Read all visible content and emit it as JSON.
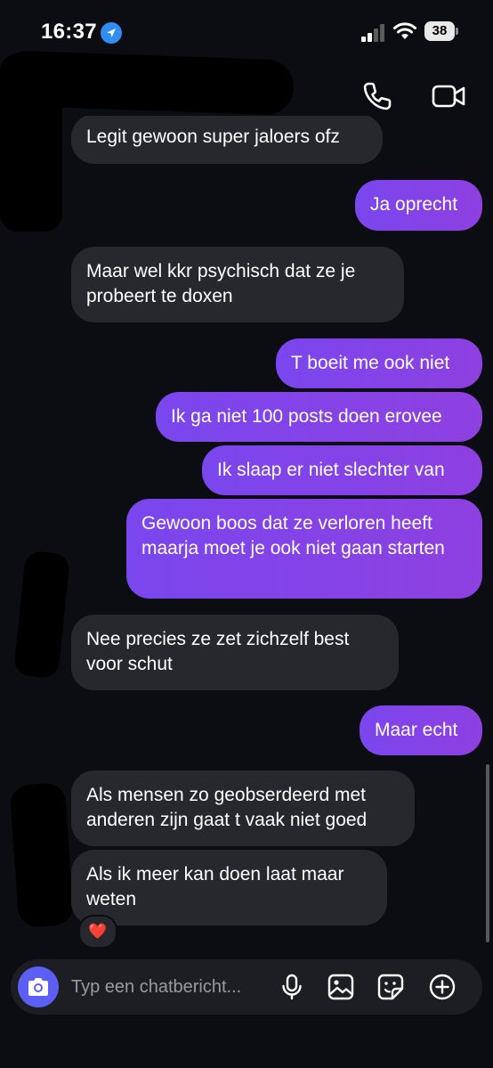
{
  "status_bar": {
    "time": "16:37",
    "battery": "38",
    "icons": [
      "location-arrow-icon",
      "signal-icon",
      "wifi-icon",
      "battery-icon"
    ]
  },
  "header": {
    "icons": [
      "phone-icon",
      "video-camera-icon"
    ]
  },
  "messages": [
    {
      "direction": "incoming",
      "text": "Legit gewoon super jaloers ofz"
    },
    {
      "direction": "outgoing",
      "text": "Ja oprecht"
    },
    {
      "direction": "incoming",
      "text": "Maar wel kkr psychisch dat ze je probeert te doxen"
    },
    {
      "direction": "outgoing",
      "text": "T boeit me ook niet"
    },
    {
      "direction": "outgoing",
      "text": "Ik ga niet 100 posts doen erovee"
    },
    {
      "direction": "outgoing",
      "text": "Ik slaap er niet slechter van"
    },
    {
      "direction": "outgoing",
      "text": "Gewoon boos dat ze verloren heeft maarja moet je ook niet gaan starten"
    },
    {
      "direction": "incoming",
      "text": "Nee precies ze zet zichzelf best voor schut"
    },
    {
      "direction": "outgoing",
      "text": "Maar echt"
    },
    {
      "direction": "incoming",
      "text": "Als mensen zo geobserdeerd met anderen zijn gaat t vaak niet goed"
    },
    {
      "direction": "incoming",
      "text": "Als ik meer kan doen laat maar weten"
    }
  ],
  "reaction": {
    "emoji": "❤️",
    "icon": "heart-icon"
  },
  "composer": {
    "placeholder": "Typ een chatbericht...",
    "icons": [
      "camera-icon",
      "microphone-icon",
      "image-icon",
      "sticker-icon",
      "plus-circle-icon"
    ]
  },
  "colors": {
    "background": "#0b0d12",
    "incoming_bubble": "#26282e",
    "outgoing_bubble_start": "#7a46ee",
    "outgoing_bubble_end": "#8e40e0",
    "camera_button": "#5b5ff3"
  }
}
